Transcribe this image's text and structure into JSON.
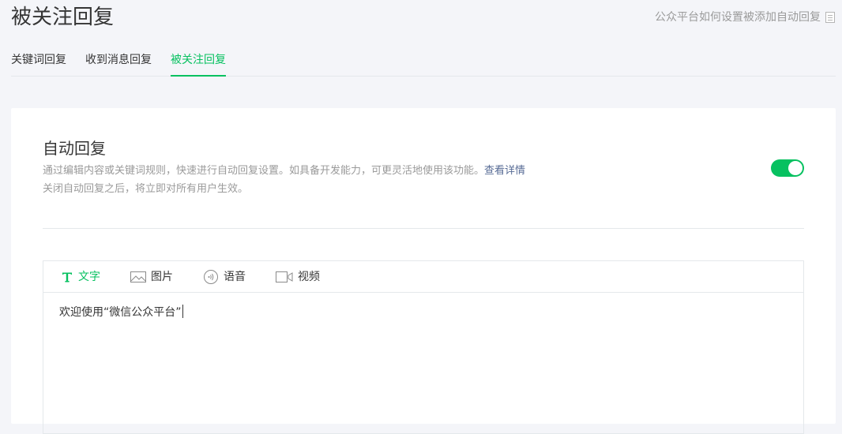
{
  "page": {
    "title": "被关注回复",
    "help_link": "公众平台如何设置被添加自动回复"
  },
  "tabs": [
    {
      "label": "关键词回复",
      "active": false
    },
    {
      "label": "收到消息回复",
      "active": false
    },
    {
      "label": "被关注回复",
      "active": true
    }
  ],
  "auto_reply": {
    "title": "自动回复",
    "desc_line1": "通过编辑内容或关键词规则，快速进行自动回复设置。如具备开发能力，可更灵活地使用该功能。",
    "detail_link": "查看详情",
    "desc_line2": "关闭自动回复之后，将立即对所有用户生效。",
    "enabled": true
  },
  "editor": {
    "tools": [
      {
        "label": "文字",
        "icon": "text-icon",
        "active": true
      },
      {
        "label": "图片",
        "icon": "image-icon",
        "active": false
      },
      {
        "label": "语音",
        "icon": "voice-icon",
        "active": false
      },
      {
        "label": "视频",
        "icon": "video-icon",
        "active": false
      }
    ],
    "content": "欢迎使用“微信公众平台”"
  },
  "colors": {
    "accent": "#07c160",
    "link": "#576b95",
    "muted": "#9a9a9a"
  }
}
